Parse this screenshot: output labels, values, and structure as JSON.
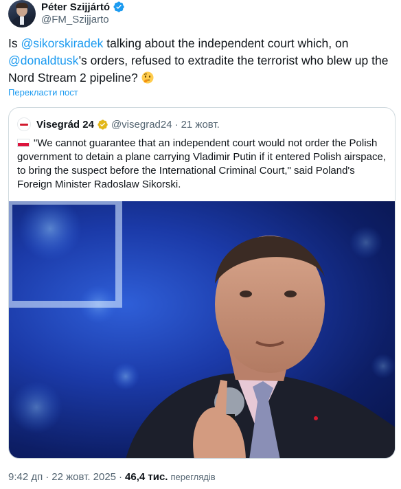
{
  "tweet": {
    "author_name": "Péter Szijjártó",
    "author_handle": "@FM_Szijjarto",
    "text_parts": [
      "Is ",
      "@sikorskiradek",
      " talking about the independent court which, on ",
      "@donaldtusk",
      "’s orders, refused to extradite the terrorist who blew up the Nord Stream 2 pipeline? "
    ],
    "emoji": "thinking-face",
    "translate_label": "Перекласти пост"
  },
  "quote": {
    "author_name": "Visegrád 24",
    "author_handle": "@visegrad24",
    "separator": "·",
    "date": "21 жовт.",
    "flag": "poland-flag",
    "text": "\"We cannot guarantee that an independent court would not order the Polish government to detain a plane carrying Vladimir Putin if it entered Polish airspace, to bring the suspect before the International Criminal Court,\" said Poland's Foreign Minister Radoslaw Sikorski."
  },
  "footer": {
    "time": "9:42 дп",
    "separator": "·",
    "date": "22 жовт. 2025",
    "views_count": "46,4 тис.",
    "views_label": "переглядів"
  },
  "colors": {
    "link": "#1d9bf0",
    "text": "#0f1419",
    "muted": "#536471",
    "verified_blue": "#1d9bf0",
    "verified_gold": "#e2b719",
    "border": "#cfd9de"
  }
}
